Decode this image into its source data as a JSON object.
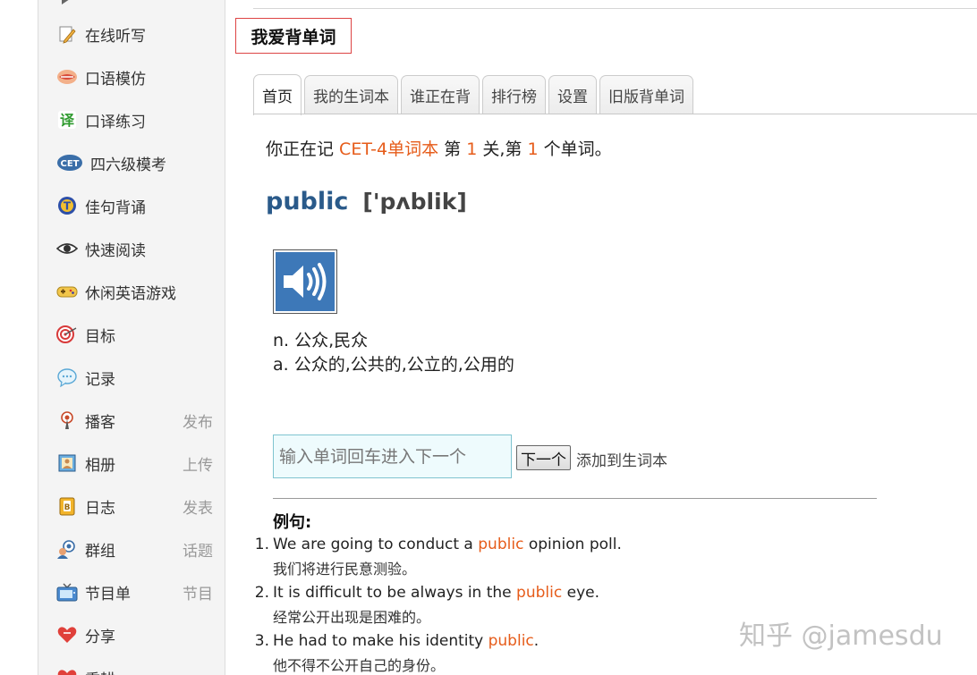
{
  "sidebar": {
    "items": [
      {
        "label": "在线听写",
        "extra": "",
        "icon": "pencil-paper-icon"
      },
      {
        "label": "口语模仿",
        "extra": "",
        "icon": "lips-icon"
      },
      {
        "label": "口译练习",
        "extra": "",
        "icon": "translate-char-icon"
      },
      {
        "label": "四六级模考",
        "extra": "",
        "icon": "cet-badge-icon"
      },
      {
        "label": "佳句背诵",
        "extra": "",
        "icon": "t-circle-icon"
      },
      {
        "label": "快速阅读",
        "extra": "",
        "icon": "eye-icon"
      },
      {
        "label": "休闲英语游戏",
        "extra": "",
        "icon": "gamepad-icon"
      },
      {
        "label": "目标",
        "extra": "",
        "icon": "target-icon"
      },
      {
        "label": "记录",
        "extra": "",
        "icon": "chat-bubble-icon"
      },
      {
        "label": "播客",
        "extra": "发布",
        "icon": "podcast-icon"
      },
      {
        "label": "相册",
        "extra": "上传",
        "icon": "photo-album-icon"
      },
      {
        "label": "日志",
        "extra": "发表",
        "icon": "blog-icon"
      },
      {
        "label": "群组",
        "extra": "话题",
        "icon": "group-icon"
      },
      {
        "label": "节目单",
        "extra": "节目",
        "icon": "tv-icon"
      },
      {
        "label": "分享",
        "extra": "",
        "icon": "heart-share-icon"
      },
      {
        "label": "重耕",
        "extra": "",
        "icon": "heart-icon"
      }
    ]
  },
  "header": {
    "title": "我爱背单词"
  },
  "tabs": [
    "首页",
    "我的生词本",
    "谁正在背",
    "排行榜",
    "设置",
    "旧版背单词"
  ],
  "active_tab": 0,
  "progress": {
    "prefix": "你正在记 ",
    "book": "CET-4单词本",
    "mid1": " 第 ",
    "level": "1",
    "mid2": " 关,第 ",
    "index": "1",
    "suffix": " 个单词。"
  },
  "word": {
    "text": "public",
    "phonetic": "['pʌblik]",
    "definitions": [
      "n. 公众,民众",
      "a. 公众的,公共的,公立的,公用的"
    ]
  },
  "input": {
    "placeholder": "输入单词回车进入下一个"
  },
  "buttons": {
    "next": "下一个",
    "add_to_book": "添加到生词本"
  },
  "examples": {
    "title": "例句:",
    "items": [
      {
        "num": "1.",
        "before": "We are going to conduct a ",
        "keyword": "public",
        "after": " opinion poll.",
        "zh": "我们将进行民意测验。"
      },
      {
        "num": "2.",
        "before": "It is difficult to be always in the ",
        "keyword": "public",
        "after": " eye.",
        "zh": "经常公开出现是困难的。"
      },
      {
        "num": "3.",
        "before": "He had to make his identity ",
        "keyword": "public",
        "after": ".",
        "zh": "他不得不公开自己的身份。"
      }
    ]
  },
  "watermark": "知乎 @jamesdu",
  "colors": {
    "accent": "#e65c1a",
    "word": "#2a5a8a",
    "speaker": "#3d78b8"
  }
}
